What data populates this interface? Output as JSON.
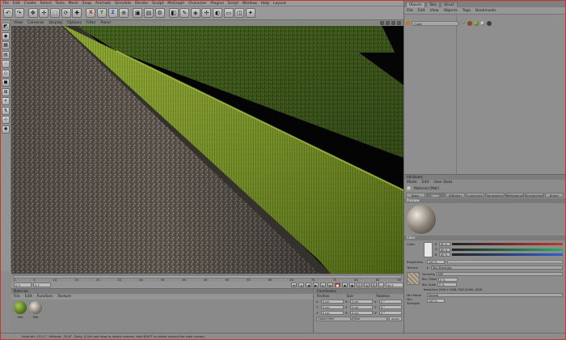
{
  "menu": {
    "items": [
      "File",
      "Edit",
      "Create",
      "Select",
      "Tools",
      "Mesh",
      "Snap",
      "Animate",
      "Simulate",
      "Render",
      "Sculpt",
      "MoGraph",
      "Character",
      "Plugins",
      "Script",
      "Window",
      "Help",
      "Layout"
    ]
  },
  "viewport": {
    "menu": [
      "View",
      "Cameras",
      "Display",
      "Options",
      "Filter",
      "Panel"
    ]
  },
  "timeline": {
    "ticks": [
      "0",
      "5",
      "10",
      "15",
      "20",
      "25",
      "30",
      "35",
      "40",
      "45",
      "50",
      "55",
      "60",
      "65",
      "70",
      "75",
      "80",
      "85",
      "90"
    ],
    "current_frame": "0 F",
    "start_frame": "0 F",
    "end_frame": "90 F"
  },
  "material_manager": {
    "title": "Materials",
    "menu": [
      "File",
      "Edit",
      "Function",
      "Texture"
    ],
    "materials": [
      {
        "name": "Mat",
        "icon": "grass-material-icon"
      },
      {
        "name": "Mat",
        "icon": "stone-material-icon"
      }
    ]
  },
  "coordinates": {
    "title": "Coordinates",
    "headers": [
      "Position",
      "Size",
      "Rotation"
    ],
    "rows": [
      {
        "axis": "X",
        "position": "0 cm",
        "size": "0 cm",
        "rotation": "0 °"
      },
      {
        "axis": "Y",
        "position": "0 cm",
        "size": "0 cm",
        "rotation": "0 °"
      },
      {
        "axis": "Z",
        "position": "0 cm",
        "size": "0 cm",
        "rotation": "0 °"
      }
    ],
    "mode": "Object (Rel)",
    "size_mode": "Size",
    "apply": "Apply"
  },
  "statusbar": {
    "text": "Azimuth: 131.2°, Altitude: -32.8°, Dolly: [Click and drag to rotate camera. Hold SHIFT to rotate around the view center]"
  },
  "object_manager": {
    "tabs": [
      "Objects",
      "Take",
      "Struct"
    ],
    "menu": [
      "File",
      "Edit",
      "View",
      "Objects",
      "Tags",
      "Bookmarks"
    ],
    "object_name": "Cube"
  },
  "attribute_manager": {
    "title": "Attributes",
    "menu": [
      "Mode",
      "Edit",
      "User Data"
    ],
    "material_name": "Material [Mat]",
    "tabs": [
      "Basic",
      "Color",
      "Diffusion",
      "Luminance",
      "Transparency",
      "Reflectance",
      "Environment",
      "Bump"
    ],
    "active_tab": "Color",
    "preview_label": "Preview",
    "color_section": "Color",
    "color_label": "Color",
    "channels": [
      {
        "ch": "R",
        "value": "80 %",
        "color": "#c0392b"
      },
      {
        "ch": "G",
        "value": "80 %",
        "color": "#27ae60"
      },
      {
        "ch": "B",
        "value": "80 %",
        "color": "#2f5fcf"
      }
    ],
    "brightness_label": "Brightness",
    "brightness_value": "100 %",
    "texture_label": "Texture",
    "texture_file": "Tex_Stone.jpg",
    "sampling_label": "Sampling",
    "sampling_value": "MIP",
    "blur_offset_label": "Blur Offset",
    "blur_offset_value": "0 %",
    "blur_scale_label": "Blur Scale",
    "blur_scale_value": "0 %",
    "texture_info": "Resolution 2048 x 2048, RGB (8 Bit), sRGB",
    "mix_mode_label": "Mix Mode",
    "mix_mode_value": "Normal",
    "mix_strength_label": "Mix Strength",
    "mix_strength_value": "100 %"
  }
}
